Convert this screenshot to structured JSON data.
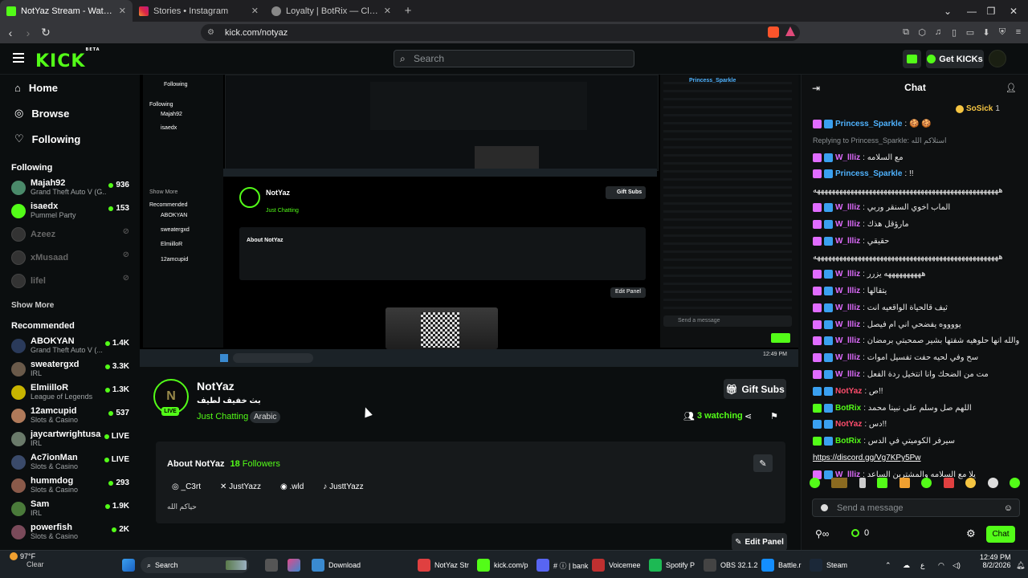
{
  "browser": {
    "tabs": [
      {
        "title": "NotYaz Stream - Watch Live on K",
        "active": true
      },
      {
        "title": "Stories • Instagram",
        "active": false
      },
      {
        "title": "Loyalty | BotRix — Cloud Streaming B",
        "active": false
      }
    ],
    "url": "kick.com/notyaz"
  },
  "header": {
    "logo": "KICK",
    "logo_tag": "BETA",
    "search_placeholder": "Search",
    "get_kicks": "Get KICKs"
  },
  "sidebar": {
    "nav": [
      {
        "label": "Home",
        "icon": "home-icon"
      },
      {
        "label": "Browse",
        "icon": "compass-icon"
      },
      {
        "label": "Following",
        "icon": "heart-icon"
      }
    ],
    "following_title": "Following",
    "following": [
      {
        "name": "Majah92",
        "category": "Grand Theft Auto V (G...",
        "viewers": "936",
        "live": true,
        "color": "#4a8a6a"
      },
      {
        "name": "isaedx",
        "category": "Pummel Party",
        "viewers": "153",
        "live": true,
        "color": "#53fc18"
      },
      {
        "name": "Azeez",
        "category": "",
        "viewers": "",
        "live": false,
        "color": "#333"
      },
      {
        "name": "xMusaad",
        "category": "",
        "viewers": "",
        "live": false,
        "color": "#333"
      },
      {
        "name": "lifel",
        "category": "",
        "viewers": "",
        "live": false,
        "color": "#333"
      }
    ],
    "show_more": "Show More",
    "recommended_title": "Recommended",
    "recommended": [
      {
        "name": "ABOKYAN",
        "category": "Grand Theft Auto V (...",
        "viewers": "1.4K",
        "color": "#2a3a5a"
      },
      {
        "name": "sweatergxd",
        "category": "IRL",
        "viewers": "3.3K",
        "color": "#6a5a4a"
      },
      {
        "name": "ElmiilloR",
        "category": "League of Legends",
        "viewers": "1.3K",
        "color": "#c8b400"
      },
      {
        "name": "12amcupid",
        "category": "Slots & Casino",
        "viewers": "537",
        "color": "#b07a5a"
      },
      {
        "name": "jaycartwrightusa",
        "category": "IRL",
        "viewers": "LIVE",
        "color": "#6a7a6a"
      },
      {
        "name": "Ac7ionMan",
        "category": "Slots & Casino",
        "viewers": "LIVE",
        "color": "#3a4a6a"
      },
      {
        "name": "hummdog",
        "category": "Slots & Casino",
        "viewers": "293",
        "color": "#8a5a4a"
      },
      {
        "name": "Sam",
        "category": "IRL",
        "viewers": "1.9K",
        "color": "#4a7a3a"
      },
      {
        "name": "powerfish",
        "category": "Slots & Casino",
        "viewers": "2K",
        "color": "#7a4a5a"
      }
    ]
  },
  "stream": {
    "streamer": "NotYaz",
    "title": "بث خفيف لطيف",
    "category": "Just Chatting",
    "tag": "Arabic",
    "live_label": "LIVE",
    "watching_count": "3",
    "watching_label": "watching",
    "gift_subs": "Gift Subs"
  },
  "about": {
    "title": "About NotYaz",
    "followers_count": "18",
    "followers_label": "Followers",
    "socials": [
      {
        "icon": "instagram-icon",
        "label": "_C3rt"
      },
      {
        "icon": "x-icon",
        "label": "JustYazz"
      },
      {
        "icon": "discord-icon",
        "label": ".wld"
      },
      {
        "icon": "tiktok-icon",
        "label": "JusttYazz"
      }
    ],
    "bio": "حياكم الله",
    "edit_panel": "Edit Panel"
  },
  "chat": {
    "title": "Chat",
    "pinned_user": "SoSick",
    "pinned_count": "1",
    "messages": [
      {
        "user": "Princess_Sparkle",
        "color": "#4fb3ff",
        "text": ": 🍪 🍪"
      },
      {
        "reply": "Replying to Princess_Sparkle: استلاكم الله"
      },
      {
        "user": "W_llliz",
        "color": "#e06cff",
        "text": ": مع السلامه"
      },
      {
        "user": "Princess_Sparkle",
        "color": "#4fb3ff",
        "text": ": !!"
      },
      {
        "text": "ههههههههههههههههههههههههههههههههههههههههههههههههههه"
      },
      {
        "user": "W_llliz",
        "color": "#e06cff",
        "text": ": الماب اخوي السنقر وربي"
      },
      {
        "user": "W_llliz",
        "color": "#e06cff",
        "text": ": مارؤقل هذك"
      },
      {
        "user": "W_llliz",
        "color": "#e06cff",
        "text": ": حقيقي"
      },
      {
        "text": "ههههههههههههههههههههههههههههههههههههههههههههههههههه"
      },
      {
        "user": "W_llliz",
        "color": "#e06cff",
        "text": ": ههههههههههه يزرر"
      },
      {
        "user": "W_llliz",
        "color": "#e06cff",
        "text": ": يتقالها"
      },
      {
        "user": "W_llliz",
        "color": "#e06cff",
        "text": ": ثيف قالحياة الواقعيه انت"
      },
      {
        "user": "W_llliz",
        "color": "#e06cff",
        "text": ": يووووه يفضحي اني ام فيصل"
      },
      {
        "user": "W_llliz",
        "color": "#e06cff",
        "text": ": والله انها حلوهيه شفتها بشير صمحبتي برمضان"
      },
      {
        "user": "W_llliz",
        "color": "#e06cff",
        "text": ": سح وفي لحيه حفت تفسيل اموات"
      },
      {
        "user": "W_llliz",
        "color": "#e06cff",
        "text": ": مت من الضحك وانا انتخيل ردة الفعل"
      },
      {
        "user": "NotYaz",
        "color": "#ff4d6d",
        "text": ": ص!!"
      },
      {
        "user": "BotRix",
        "color": "#53fc18",
        "text": ": اللهم صل وسلم على نبينا محمد"
      },
      {
        "user": "NotYaz",
        "color": "#ff4d6d",
        "text": ": دس!!"
      },
      {
        "user": "BotRix",
        "color": "#53fc18",
        "text": ": سيرفر الكوميتي في الدس"
      },
      {
        "link": "https://discord.gg/Vg7KPy5Pw"
      },
      {
        "user": "W_llliz",
        "color": "#e06cff",
        "text": ": يلا مع السلامه والمشترين الساعد"
      }
    ],
    "input_placeholder": "Send a message",
    "points": "0",
    "chat_button": "Chat"
  },
  "taskbar": {
    "weather_temp": "97°F",
    "weather_desc": "Clear",
    "search": "Search",
    "apps": [
      {
        "label": "Download",
        "color": "#3a8ad0"
      },
      {
        "label": "NotYaz Str",
        "color": "#e04040"
      },
      {
        "label": "kick.com/p",
        "color": "#53fc18"
      },
      {
        "label": "# ⓘ | bank",
        "color": "#5865f2"
      },
      {
        "label": "Voicemee",
        "color": "#c03030"
      },
      {
        "label": "Spotify P",
        "color": "#1db954"
      },
      {
        "label": "OBS 32.1.2",
        "color": "#444"
      },
      {
        "label": "Battle.r",
        "color": "#148eff"
      },
      {
        "label": "Steam",
        "color": "#1b2838"
      }
    ],
    "time": "12:49 PM",
    "date": "8/2/2026"
  }
}
